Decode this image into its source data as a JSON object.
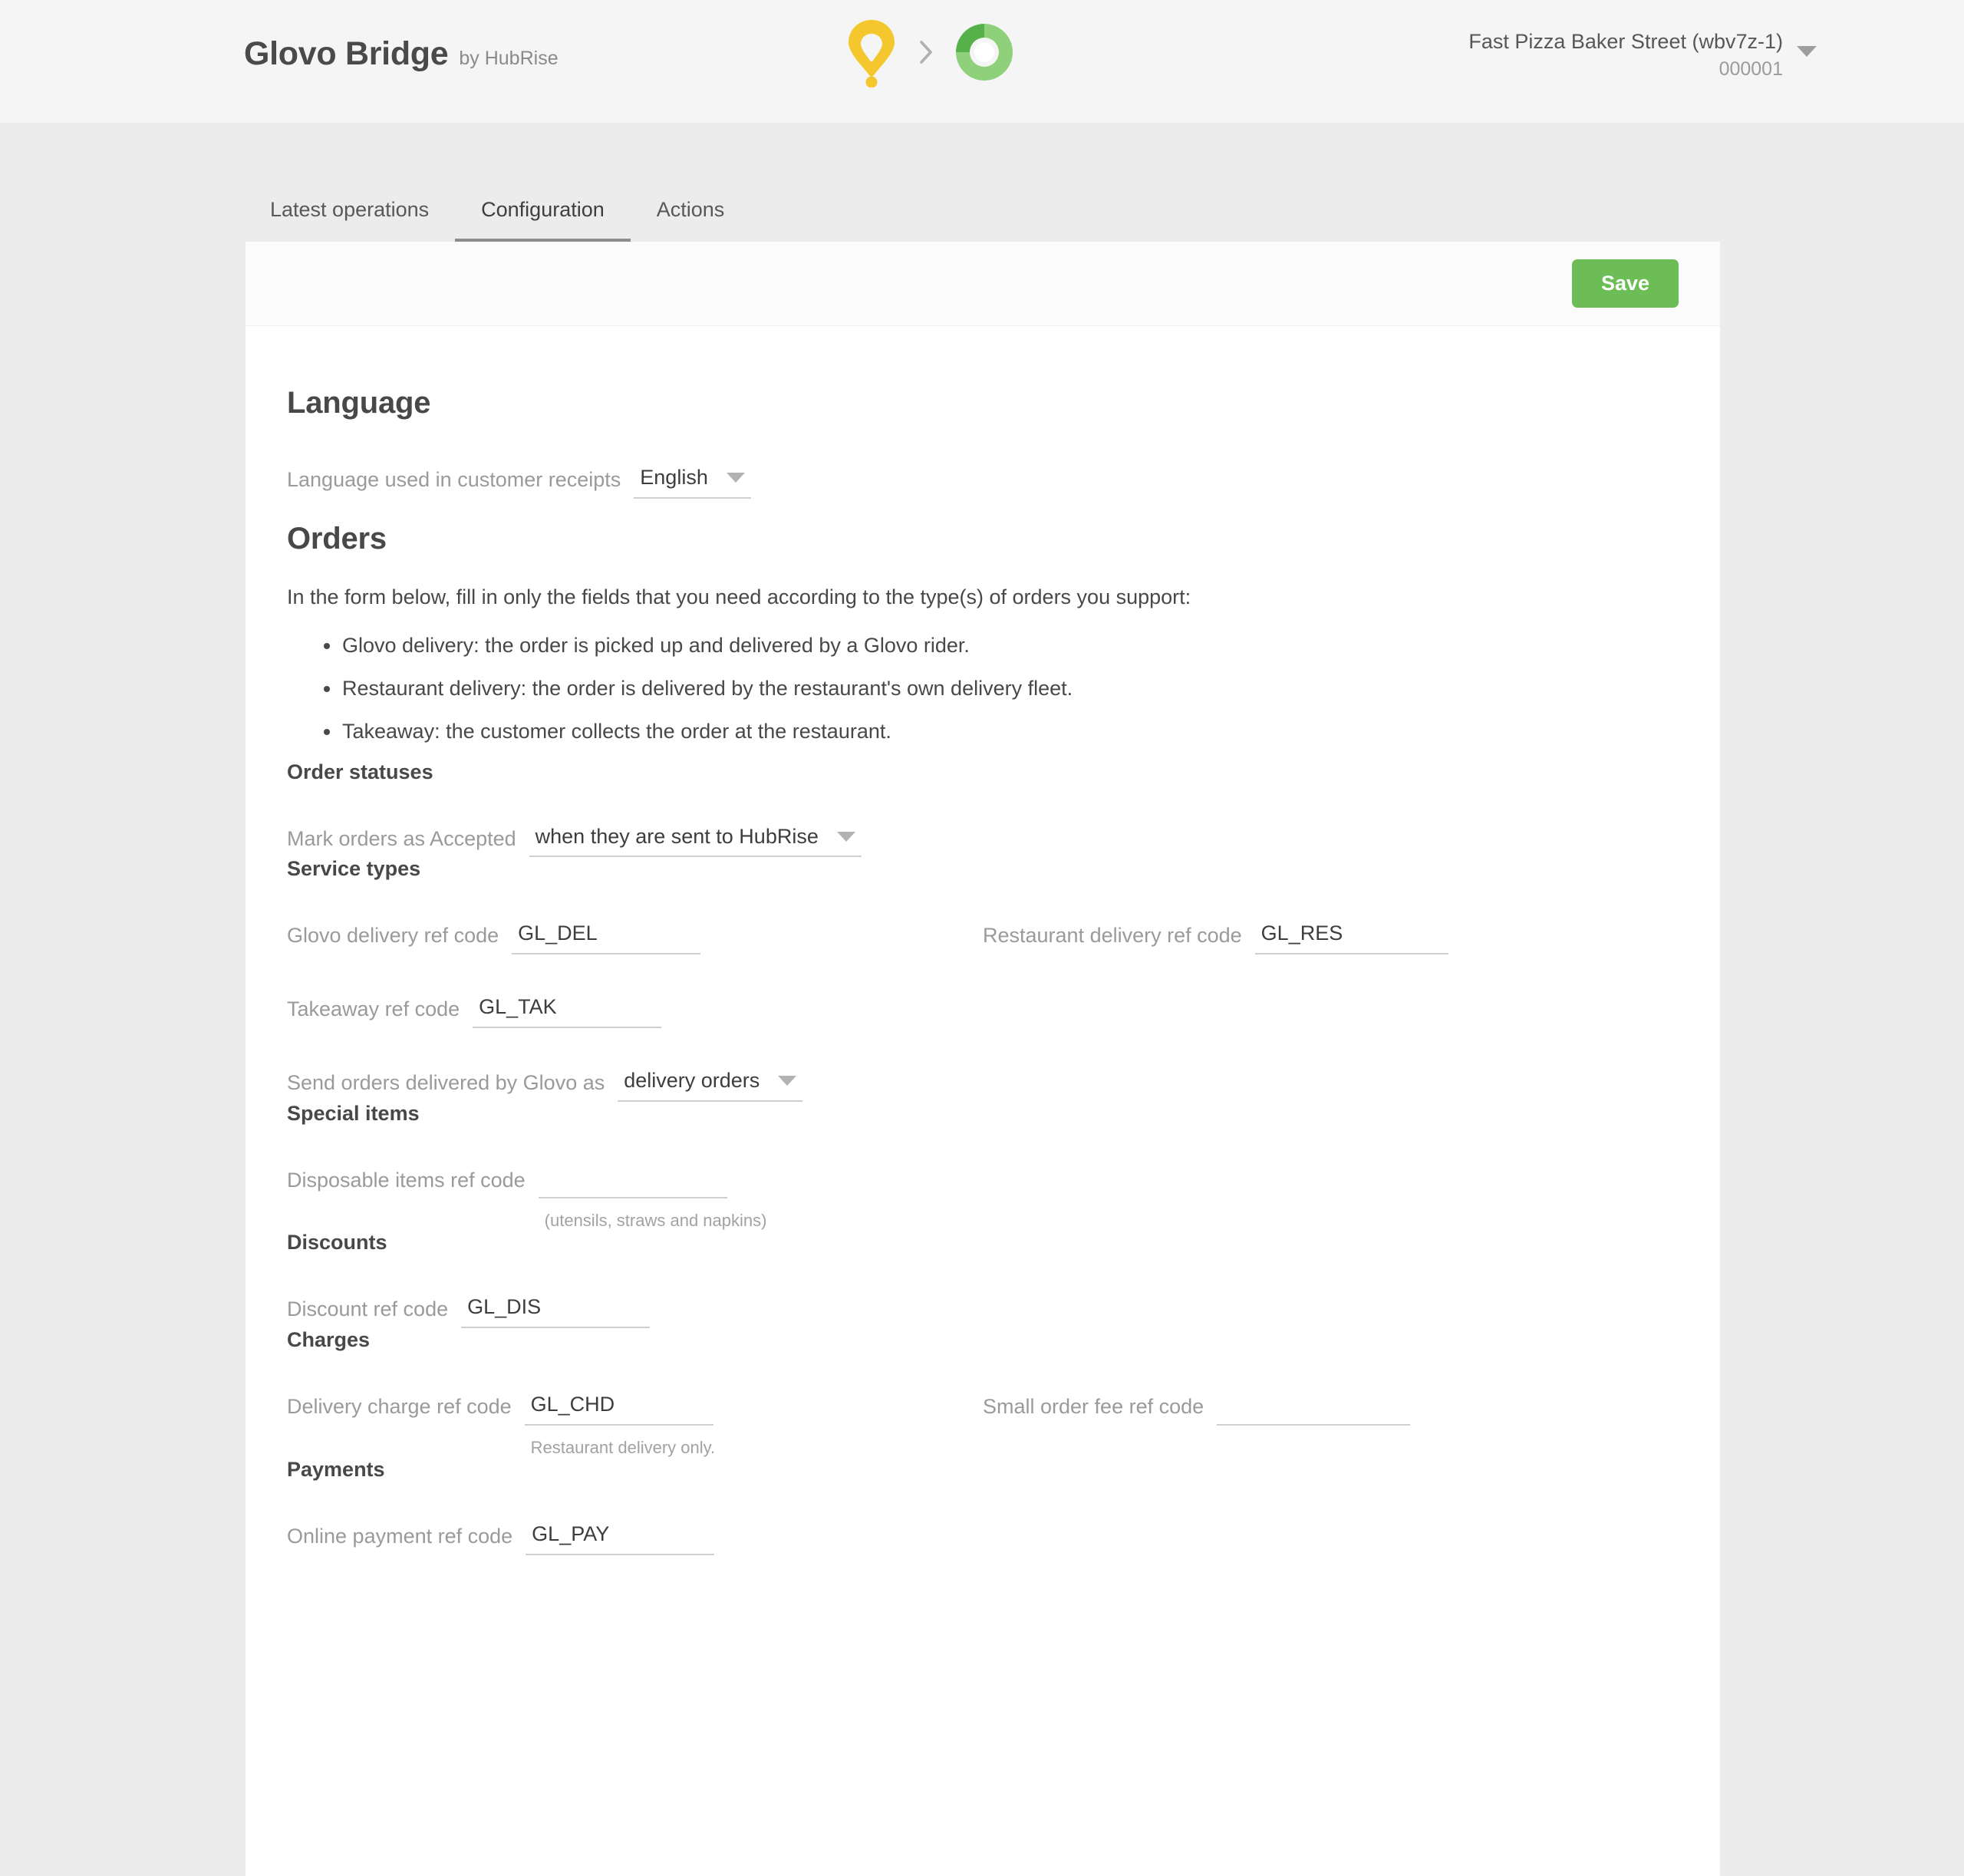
{
  "header": {
    "brand_title": "Glovo Bridge",
    "brand_subtitle": "by HubRise",
    "source_logo": "glovo-pin-icon",
    "arrow_icon": "chevron-right-icon",
    "target_logo": "hubrise-circle-icon",
    "account_name": "Fast Pizza Baker Street (wbv7z-1)",
    "account_id": "000001",
    "account_caret": "caret-down-icon"
  },
  "tabs": [
    {
      "label": "Latest operations",
      "active": false
    },
    {
      "label": "Configuration",
      "active": true
    },
    {
      "label": "Actions",
      "active": false
    }
  ],
  "toolbar": {
    "save_label": "Save"
  },
  "language": {
    "heading": "Language",
    "field_label": "Language used in customer receipts",
    "value": "English"
  },
  "orders": {
    "heading": "Orders",
    "intro": "In the form below, fill in only the fields that you need according to the type(s) of orders you support:",
    "bullets": [
      "Glovo delivery: the order is picked up and delivered by a Glovo rider.",
      "Restaurant delivery: the order is delivered by the restaurant's own delivery fleet.",
      "Takeaway: the customer collects the order at the restaurant."
    ]
  },
  "order_statuses": {
    "heading": "Order statuses",
    "mark_label": "Mark orders as Accepted",
    "mark_value": "when they are sent to HubRise"
  },
  "service_types": {
    "heading": "Service types",
    "glovo_delivery_label": "Glovo delivery ref code",
    "glovo_delivery_value": "GL_DEL",
    "restaurant_delivery_label": "Restaurant delivery ref code",
    "restaurant_delivery_value": "GL_RES",
    "takeaway_label": "Takeaway ref code",
    "takeaway_value": "GL_TAK",
    "send_as_label": "Send orders delivered by Glovo as",
    "send_as_value": "delivery orders"
  },
  "special_items": {
    "heading": "Special items",
    "disposable_label": "Disposable items ref code",
    "disposable_value": "",
    "disposable_hint": "(utensils, straws and napkins)"
  },
  "discounts": {
    "heading": "Discounts",
    "discount_label": "Discount ref code",
    "discount_value": "GL_DIS"
  },
  "charges": {
    "heading": "Charges",
    "delivery_charge_label": "Delivery charge ref code",
    "delivery_charge_value": "GL_CHD",
    "delivery_charge_hint": "Restaurant delivery only.",
    "small_order_fee_label": "Small order fee ref code",
    "small_order_fee_value": ""
  },
  "payments": {
    "heading": "Payments",
    "online_payment_label": "Online payment ref code",
    "online_payment_value": "GL_PAY"
  },
  "colors": {
    "accent_green": "#6cbd55",
    "glovo_yellow": "#f5c72e",
    "hubrise_green_dark": "#57b14b",
    "hubrise_green_light": "#8fd07a",
    "page_bg": "#ececec",
    "header_bg": "#f5f5f5",
    "card_bg": "#ffffff"
  }
}
